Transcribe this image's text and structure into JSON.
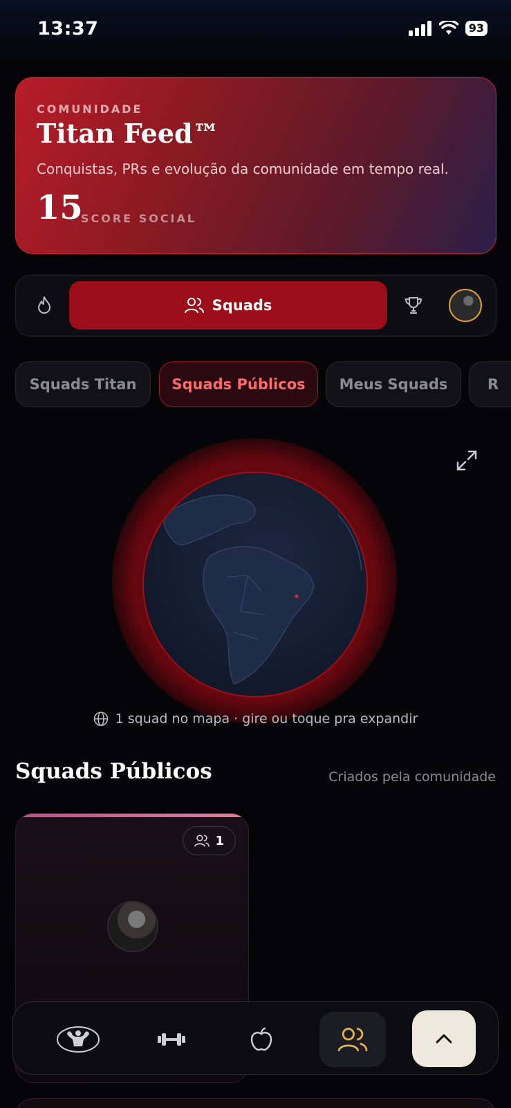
{
  "status": {
    "time": "13:37",
    "battery": "93"
  },
  "hero": {
    "kicker": "COMUNIDADE",
    "title": "Titan Feed™",
    "subtitle": "Conquistas, PRs e evolução da comunidade em tempo real.",
    "score": "15",
    "score_label": "SCORE SOCIAL"
  },
  "segmented": {
    "items": [
      {
        "icon": "flame-icon"
      },
      {
        "icon": "users-icon",
        "label": "Squads",
        "active": true
      },
      {
        "icon": "trophy-icon"
      },
      {
        "icon": "avatar"
      }
    ]
  },
  "chips": [
    {
      "label": "Squads Titan",
      "active": false
    },
    {
      "label": "Squads Públicos",
      "active": true
    },
    {
      "label": "Meus Squads",
      "active": false
    },
    {
      "label": "R",
      "active": false
    }
  ],
  "globe": {
    "caption": "1 squad no mapa · gire ou toque pra expandir",
    "accent": "#c8141e"
  },
  "section": {
    "title": "Squads Públicos",
    "subtitle": "Criados pela comunidade"
  },
  "squad_card": {
    "member_count": "1"
  },
  "bottom_nav": {
    "items": [
      {
        "icon": "bodybuilder-logo-icon"
      },
      {
        "icon": "dumbbell-icon"
      },
      {
        "icon": "apple-icon"
      },
      {
        "icon": "users-icon",
        "active": true
      },
      {
        "icon": "chevron-up-icon"
      }
    ]
  },
  "colors": {
    "primary": "#9b0d19",
    "fab": "#efe8dc",
    "chip_active_text": "#ff6b6b"
  }
}
